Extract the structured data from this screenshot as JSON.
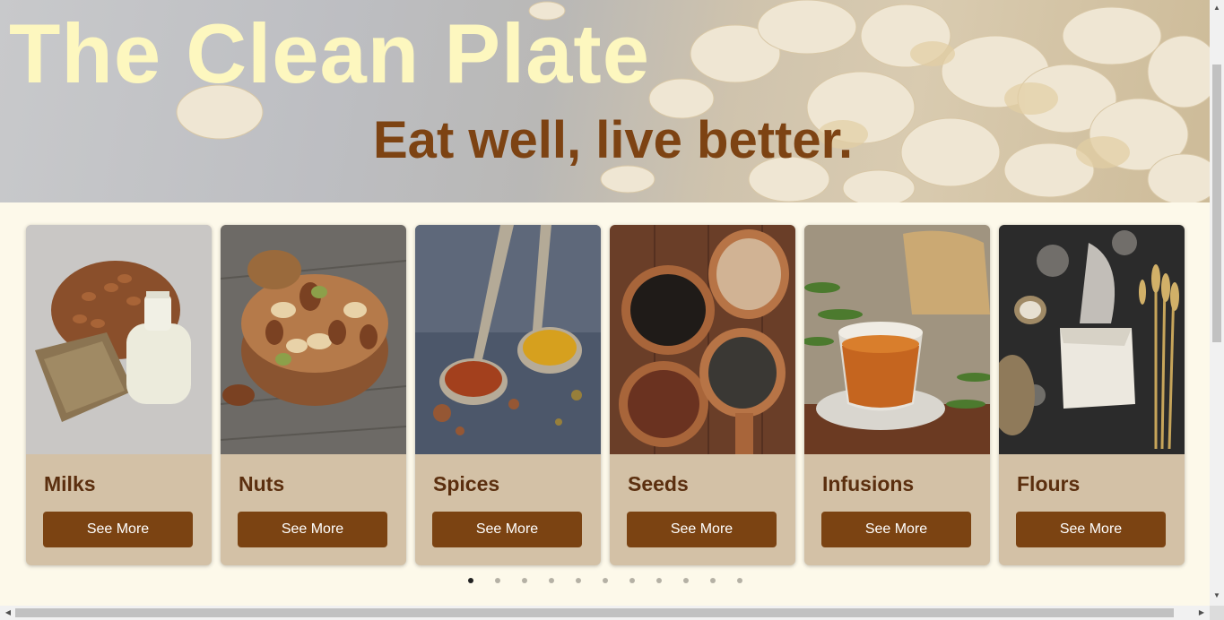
{
  "hero": {
    "title": "The Clean Plate",
    "tagline": "Eat well, live better."
  },
  "carousel": {
    "arrow_left_icon": "chevron-left-icon",
    "arrow_right_icon": "chevron-right-icon",
    "cards": [
      {
        "title": "Milks",
        "button": "See More",
        "image": "almonds-and-milk-bottle"
      },
      {
        "title": "Nuts",
        "button": "See More",
        "image": "bowl-of-mixed-nuts"
      },
      {
        "title": "Spices",
        "button": "See More",
        "image": "spoons-of-spices"
      },
      {
        "title": "Seeds",
        "button": "See More",
        "image": "spoons-of-seeds"
      },
      {
        "title": "Infusions",
        "button": "See More",
        "image": "herbal-tea-cup"
      },
      {
        "title": "Flours",
        "button": "See More",
        "image": "flour-and-wheat"
      }
    ],
    "page_count": 11,
    "active_page": 1
  },
  "colors": {
    "page_bg": "#fdf9ea",
    "title": "#fdf7bf",
    "tagline": "#7d4313",
    "card_bg": "#d3c1a6",
    "button_bg": "#7b4312",
    "card_title": "#5b2f0f"
  }
}
